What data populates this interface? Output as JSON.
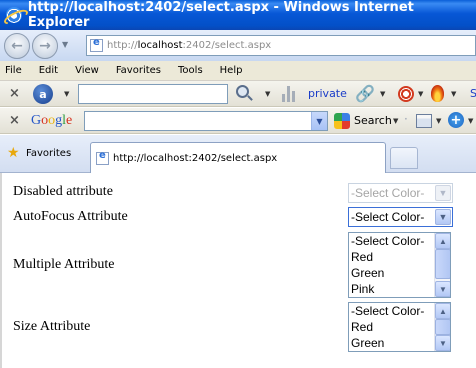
{
  "window": {
    "title": "http://localhost:2402/select.aspx - Windows Internet Explorer"
  },
  "address_bar": {
    "protocol": "http://",
    "host": "localhost",
    "path": ":2402/select.aspx"
  },
  "menu": [
    "File",
    "Edit",
    "View",
    "Favorites",
    "Tools",
    "Help"
  ],
  "ask_toolbar": {
    "link_label": "private",
    "trailing_letter": "S"
  },
  "google_toolbar": {
    "logo": "Google",
    "search_label": "Search"
  },
  "favorites": {
    "label": "Favorites"
  },
  "tab": {
    "title": "http://localhost:2402/select.aspx"
  },
  "page": {
    "rows": [
      {
        "label": "Disabled attribute",
        "selected": "-Select Color-"
      },
      {
        "label": "AutoFocus Attribute",
        "selected": "-Select Color-"
      },
      {
        "label": "Multiple Attribute",
        "options": [
          "-Select Color-",
          "Red",
          "Green",
          "Pink"
        ]
      },
      {
        "label": "Size Attribute",
        "options": [
          "-Select Color-",
          "Red",
          "Green"
        ]
      }
    ]
  },
  "colors": {
    "titlebar": "#0757d6",
    "link": "#1a3cc8"
  }
}
